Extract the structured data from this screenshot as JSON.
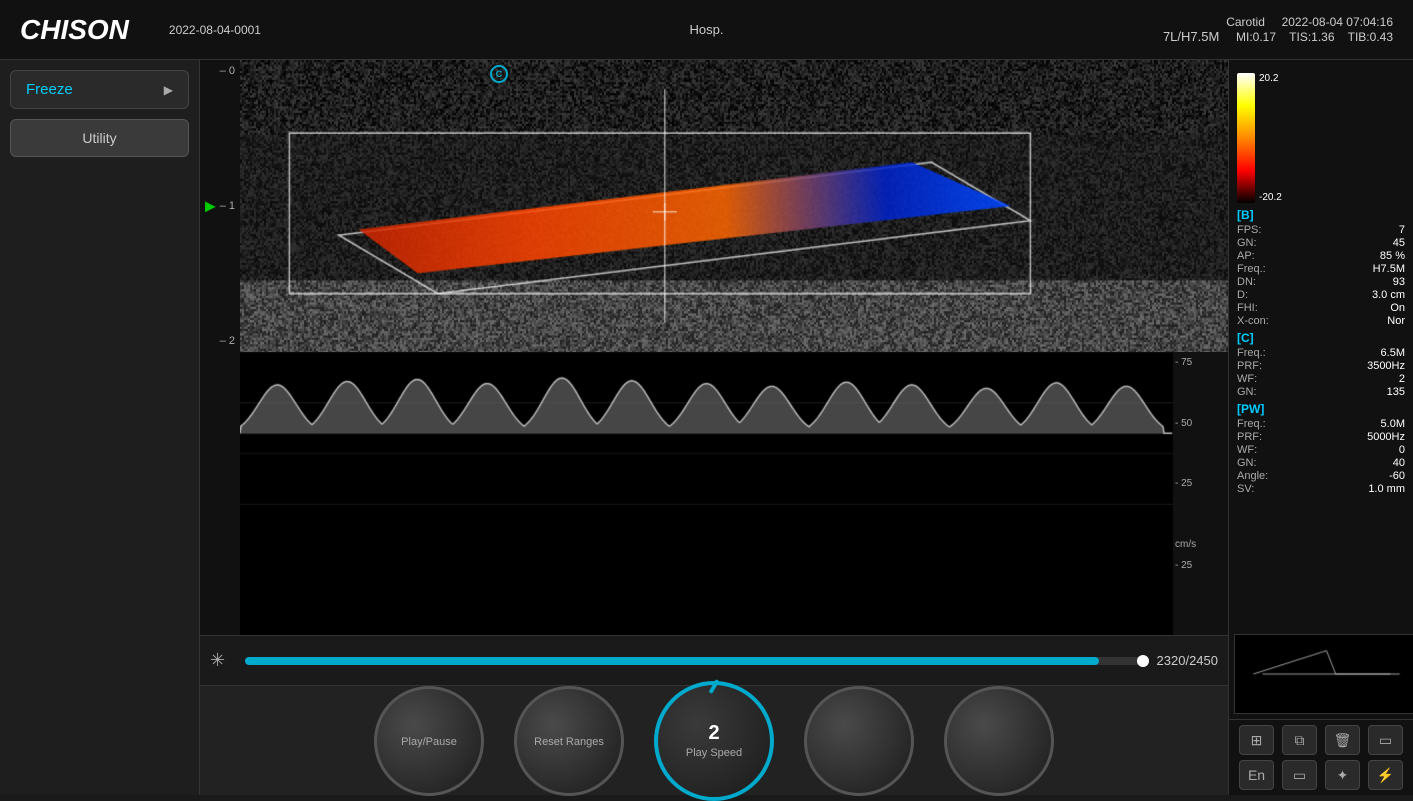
{
  "header": {
    "logo": "CHISON",
    "record_id": "2022-08-04-0001",
    "hospital": "Hosp.",
    "body_part": "Carotid",
    "datetime": "2022-08-04 07:04:16",
    "probe": "7L/H7.5M",
    "mi": "MI:0.17",
    "tis": "TIS:1.36",
    "tib": "TIB:0.43"
  },
  "sidebar": {
    "freeze_label": "Freeze",
    "utility_label": "Utility"
  },
  "params": {
    "b_section": "[B]",
    "b_fps_label": "FPS:",
    "b_fps_value": "7",
    "b_gn_label": "GN:",
    "b_gn_value": "45",
    "b_ap_label": "AP:",
    "b_ap_value": "85 %",
    "b_freq_label": "Freq.:",
    "b_freq_value": "H7.5M",
    "b_dn_label": "DN:",
    "b_dn_value": "93",
    "b_d_label": "D:",
    "b_d_value": "3.0 cm",
    "b_fhi_label": "FHI:",
    "b_fhi_value": "On",
    "b_xcon_label": "X-con:",
    "b_xcon_value": "Nor",
    "c_section": "[C]",
    "c_freq_label": "Freq.:",
    "c_freq_value": "6.5M",
    "c_prf_label": "PRF:",
    "c_prf_value": "3500Hz",
    "c_wf_label": "WF:",
    "c_wf_value": "2",
    "c_gn_label": "GN:",
    "c_gn_value": "135",
    "pw_section": "[PW]",
    "pw_freq_label": "Freq.:",
    "pw_freq_value": "5.0M",
    "pw_prf_label": "PRF:",
    "pw_prf_value": "5000Hz",
    "pw_wf_label": "WF:",
    "pw_wf_value": "0",
    "pw_gn_label": "GN:",
    "pw_gn_value": "40",
    "pw_angle_label": "Angle:",
    "pw_angle_value": "-60",
    "pw_sv_label": "SV:",
    "pw_sv_value": "1.0 mm",
    "scale_top": "20.2",
    "scale_bottom": "-20.2"
  },
  "waveform": {
    "scale_75": "- 75",
    "scale_50": "- 50",
    "scale_25": "- 25",
    "scale_0": "",
    "scale_n25": "- 25",
    "cm_s": "cm/s"
  },
  "timeline": {
    "counter": "2320/2450",
    "snowflake": "✳"
  },
  "controls": {
    "play_pause_label": "Play/Pause",
    "reset_ranges_label": "Reset Ranges",
    "play_speed_label": "Play Speed",
    "play_speed_value": "2"
  },
  "bottom_icons": {
    "grid_icon": "⊞",
    "copy_icon": "⧉",
    "trash_icon": "🗑",
    "monitor_icon": "▭",
    "usb_icon": "⚡",
    "storage_icon": "💾",
    "bluetooth_icon": "⚬",
    "battery_icon": "▭",
    "lang": "En"
  }
}
